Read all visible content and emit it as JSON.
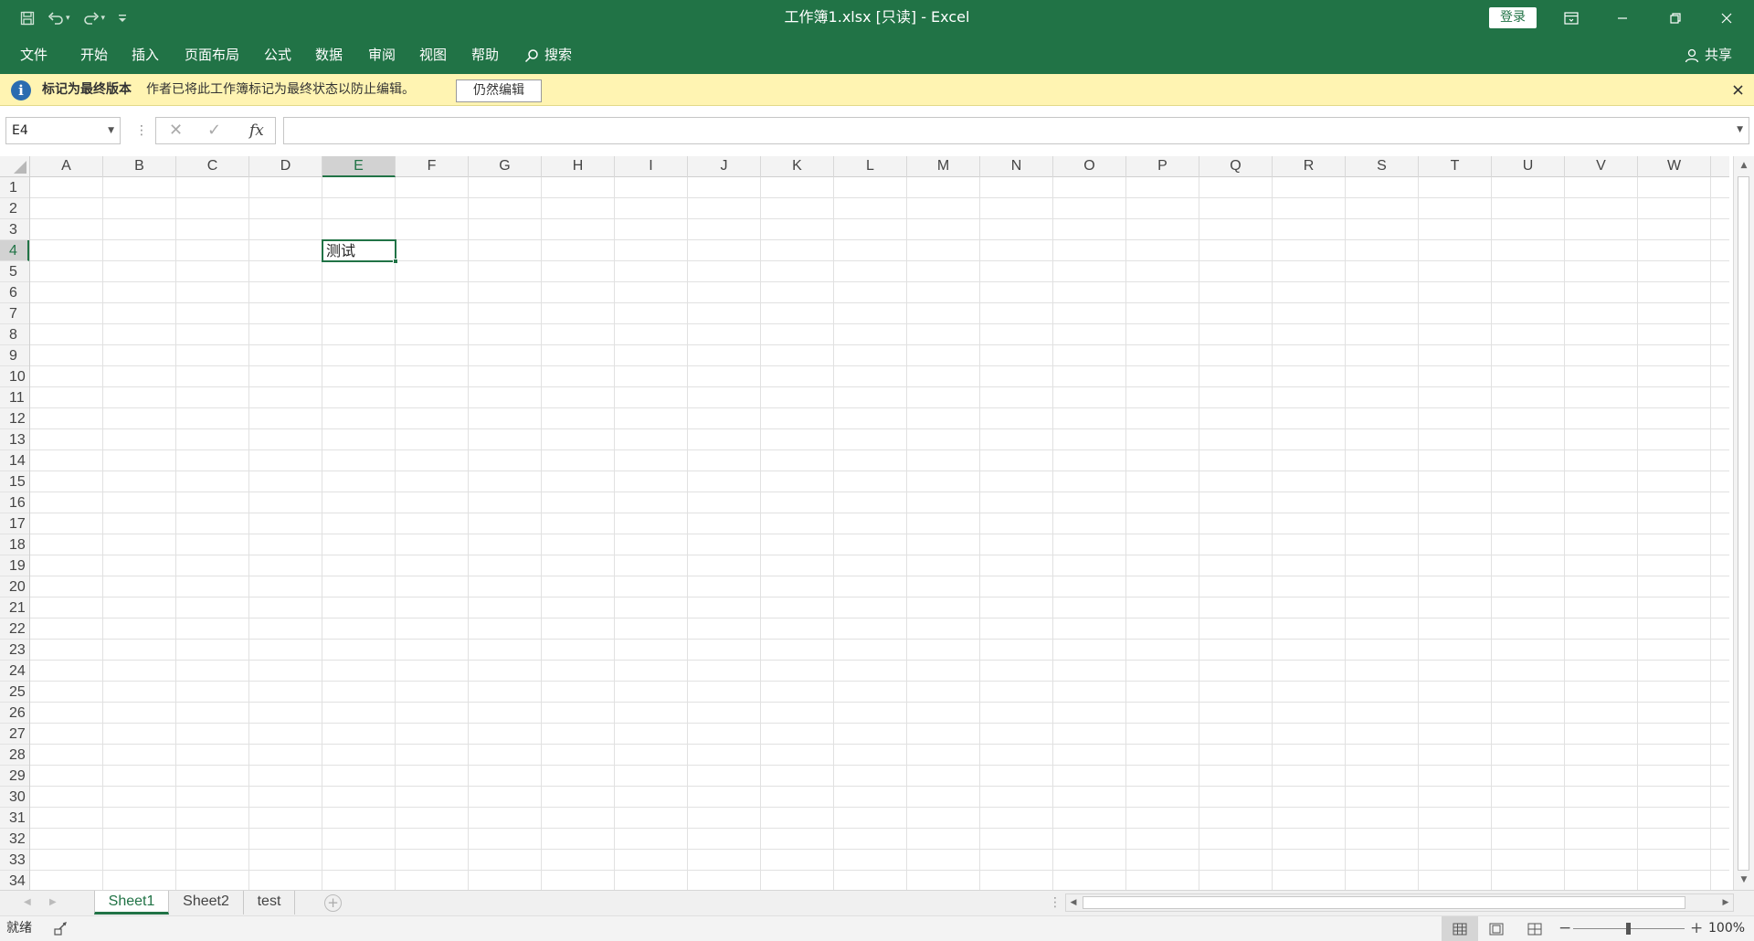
{
  "window": {
    "title": "工作簿1.xlsx  [只读]  -  Excel",
    "login_label": "登录"
  },
  "ribbon": {
    "tabs": [
      "文件",
      "开始",
      "插入",
      "页面布局",
      "公式",
      "数据",
      "审阅",
      "视图",
      "帮助",
      "搜索"
    ],
    "share_label": "共享"
  },
  "message_bar": {
    "title": "标记为最终版本",
    "text": "作者已将此工作簿标记为最终状态以防止编辑。",
    "edit_anyway_label": "仍然编辑",
    "info_icon_glyph": "i"
  },
  "formula_bar": {
    "name_box": "E4",
    "fx_label": "fx",
    "formula_value": ""
  },
  "grid": {
    "columns": [
      "A",
      "B",
      "C",
      "D",
      "E",
      "F",
      "G",
      "H",
      "I",
      "J",
      "K",
      "L",
      "M",
      "N",
      "O",
      "P",
      "Q",
      "R",
      "S",
      "T",
      "U",
      "V",
      "W"
    ],
    "rows": [
      "1",
      "2",
      "3",
      "4",
      "5",
      "6",
      "7",
      "8",
      "9",
      "10",
      "11",
      "12",
      "13",
      "14",
      "15",
      "16",
      "17",
      "18",
      "19",
      "20",
      "21",
      "22",
      "23",
      "24",
      "25",
      "26",
      "27",
      "28",
      "29",
      "30",
      "31",
      "32",
      "33",
      "34"
    ],
    "selected_column": "E",
    "selected_row": "4",
    "active_cell": {
      "ref": "E4",
      "value": "测试"
    }
  },
  "sheets": {
    "tabs": [
      "Sheet1",
      "Sheet2",
      "test"
    ],
    "active": "Sheet1"
  },
  "status": {
    "ready_label": "就绪",
    "zoom_level": "100%",
    "zoom_percent": 100
  },
  "colors": {
    "accent": "#217346",
    "message_bar_bg": "#fff4b2"
  }
}
